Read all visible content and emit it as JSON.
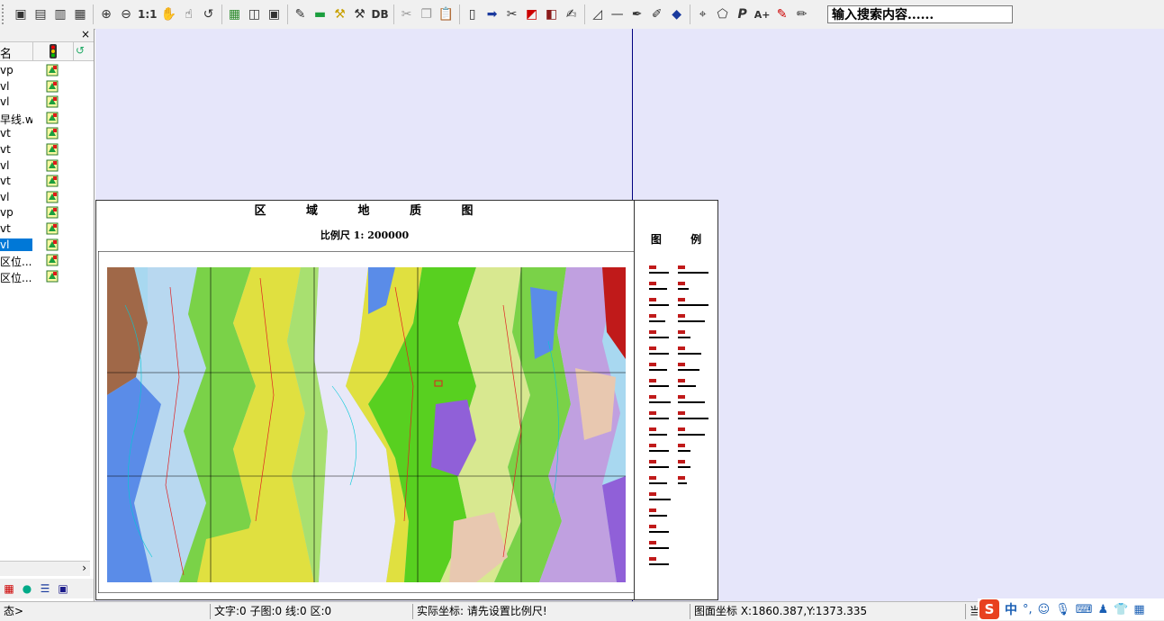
{
  "toolbar": {
    "zoom_label": "1:1",
    "db_label": "DB",
    "search_text": "输入搜索内容......",
    "buttons": [
      "save-icon",
      "save-as-icon",
      "save-all-icon",
      "save-project-icon",
      "zoom-in-icon",
      "zoom-out-icon",
      "pan-hand-icon",
      "select-hand-icon",
      "undo-icon",
      "grid-icon",
      "layers-icon",
      "map-window-icon",
      "edit-table-icon",
      "ruler-icon",
      "tools-icon",
      "hammer-icon",
      "cut-icon",
      "copy-icon",
      "paste-icon",
      "new-layer-icon",
      "arrow-icon",
      "clip-icon",
      "fill-icon",
      "stack-icon",
      "note-icon",
      "measure-icon",
      "line-icon",
      "pen-icon",
      "brush-icon",
      "globe-icon",
      "add-point-icon",
      "edit-area-icon",
      "text-tool-icon",
      "font-bigger-icon",
      "color-icon",
      "pencil-icon"
    ]
  },
  "left_panel": {
    "column_name": "名",
    "column_extra": "↺",
    "files": [
      {
        "name": "vp"
      },
      {
        "name": "vl"
      },
      {
        "name": "vl"
      },
      {
        "name": "早线.wl"
      },
      {
        "name": "vt"
      },
      {
        "name": "vt"
      },
      {
        "name": "vl"
      },
      {
        "name": "vt"
      },
      {
        "name": "vl"
      },
      {
        "name": "vp"
      },
      {
        "name": "vt"
      },
      {
        "name": "vl",
        "selected": true
      },
      {
        "name": "区位..."
      },
      {
        "name": "区位..."
      }
    ]
  },
  "map": {
    "title": "区 域 地 质 图",
    "scale": "比例尺 1: 200000",
    "legend_title": "图 例"
  },
  "status": {
    "mode": "态>",
    "counts": "文字:0 子图:0 线:0 区:0",
    "real_coord": "实际坐标: 请先设置比例尺!",
    "map_coord": "图面坐标 X:1860.387,Y:1373.335",
    "right_char": "当"
  },
  "tray": {
    "ime_label": "中",
    "ime_icon": "S"
  }
}
